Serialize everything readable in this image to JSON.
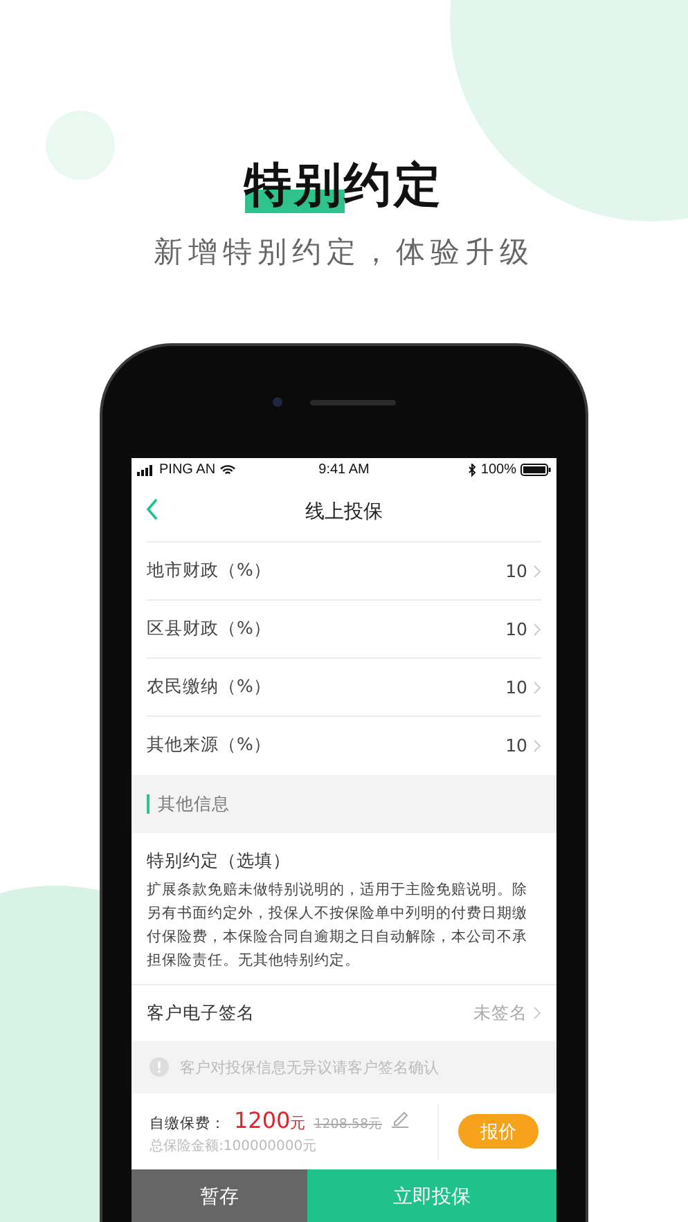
{
  "header": {
    "title": {
      "highlight": "特别",
      "rest": "约定"
    },
    "subtitle": "新增特别约定，体验升级"
  },
  "status_bar": {
    "carrier": "PING AN",
    "time": "9:41 AM",
    "battery": "100%"
  },
  "nav": {
    "title": "线上投保"
  },
  "rows": [
    {
      "label": "地市财政（%）",
      "value": "10"
    },
    {
      "label": "区县财政（%）",
      "value": "10"
    },
    {
      "label": "农民缴纳（%）",
      "value": "10"
    },
    {
      "label": "其他来源（%）",
      "value": "10"
    }
  ],
  "section": {
    "title": "其他信息"
  },
  "special": {
    "label": "特别约定（选填）",
    "text": "扩展条款免赔未做特别说明的，适用于主险免赔说明。除另有书面约定外，投保人不按保险单中列明的付费日期缴付保险费，本保险合同自逾期之日自动解除，本公司不承担保险责任。无其他特别约定。"
  },
  "signature": {
    "label": "客户电子签名",
    "value": "未签名"
  },
  "notice": "客户对投保信息无异议请客户签名确认",
  "premium": {
    "label": "自缴保费：",
    "amount": "1200",
    "unit": "元",
    "original": "1208.58元",
    "total": "总保险金额:100000000元",
    "quote_button": "报价"
  },
  "actions": [
    {
      "label": "暂存",
      "kind": "secondary"
    },
    {
      "label": "立即投保",
      "kind": "primary"
    }
  ]
}
